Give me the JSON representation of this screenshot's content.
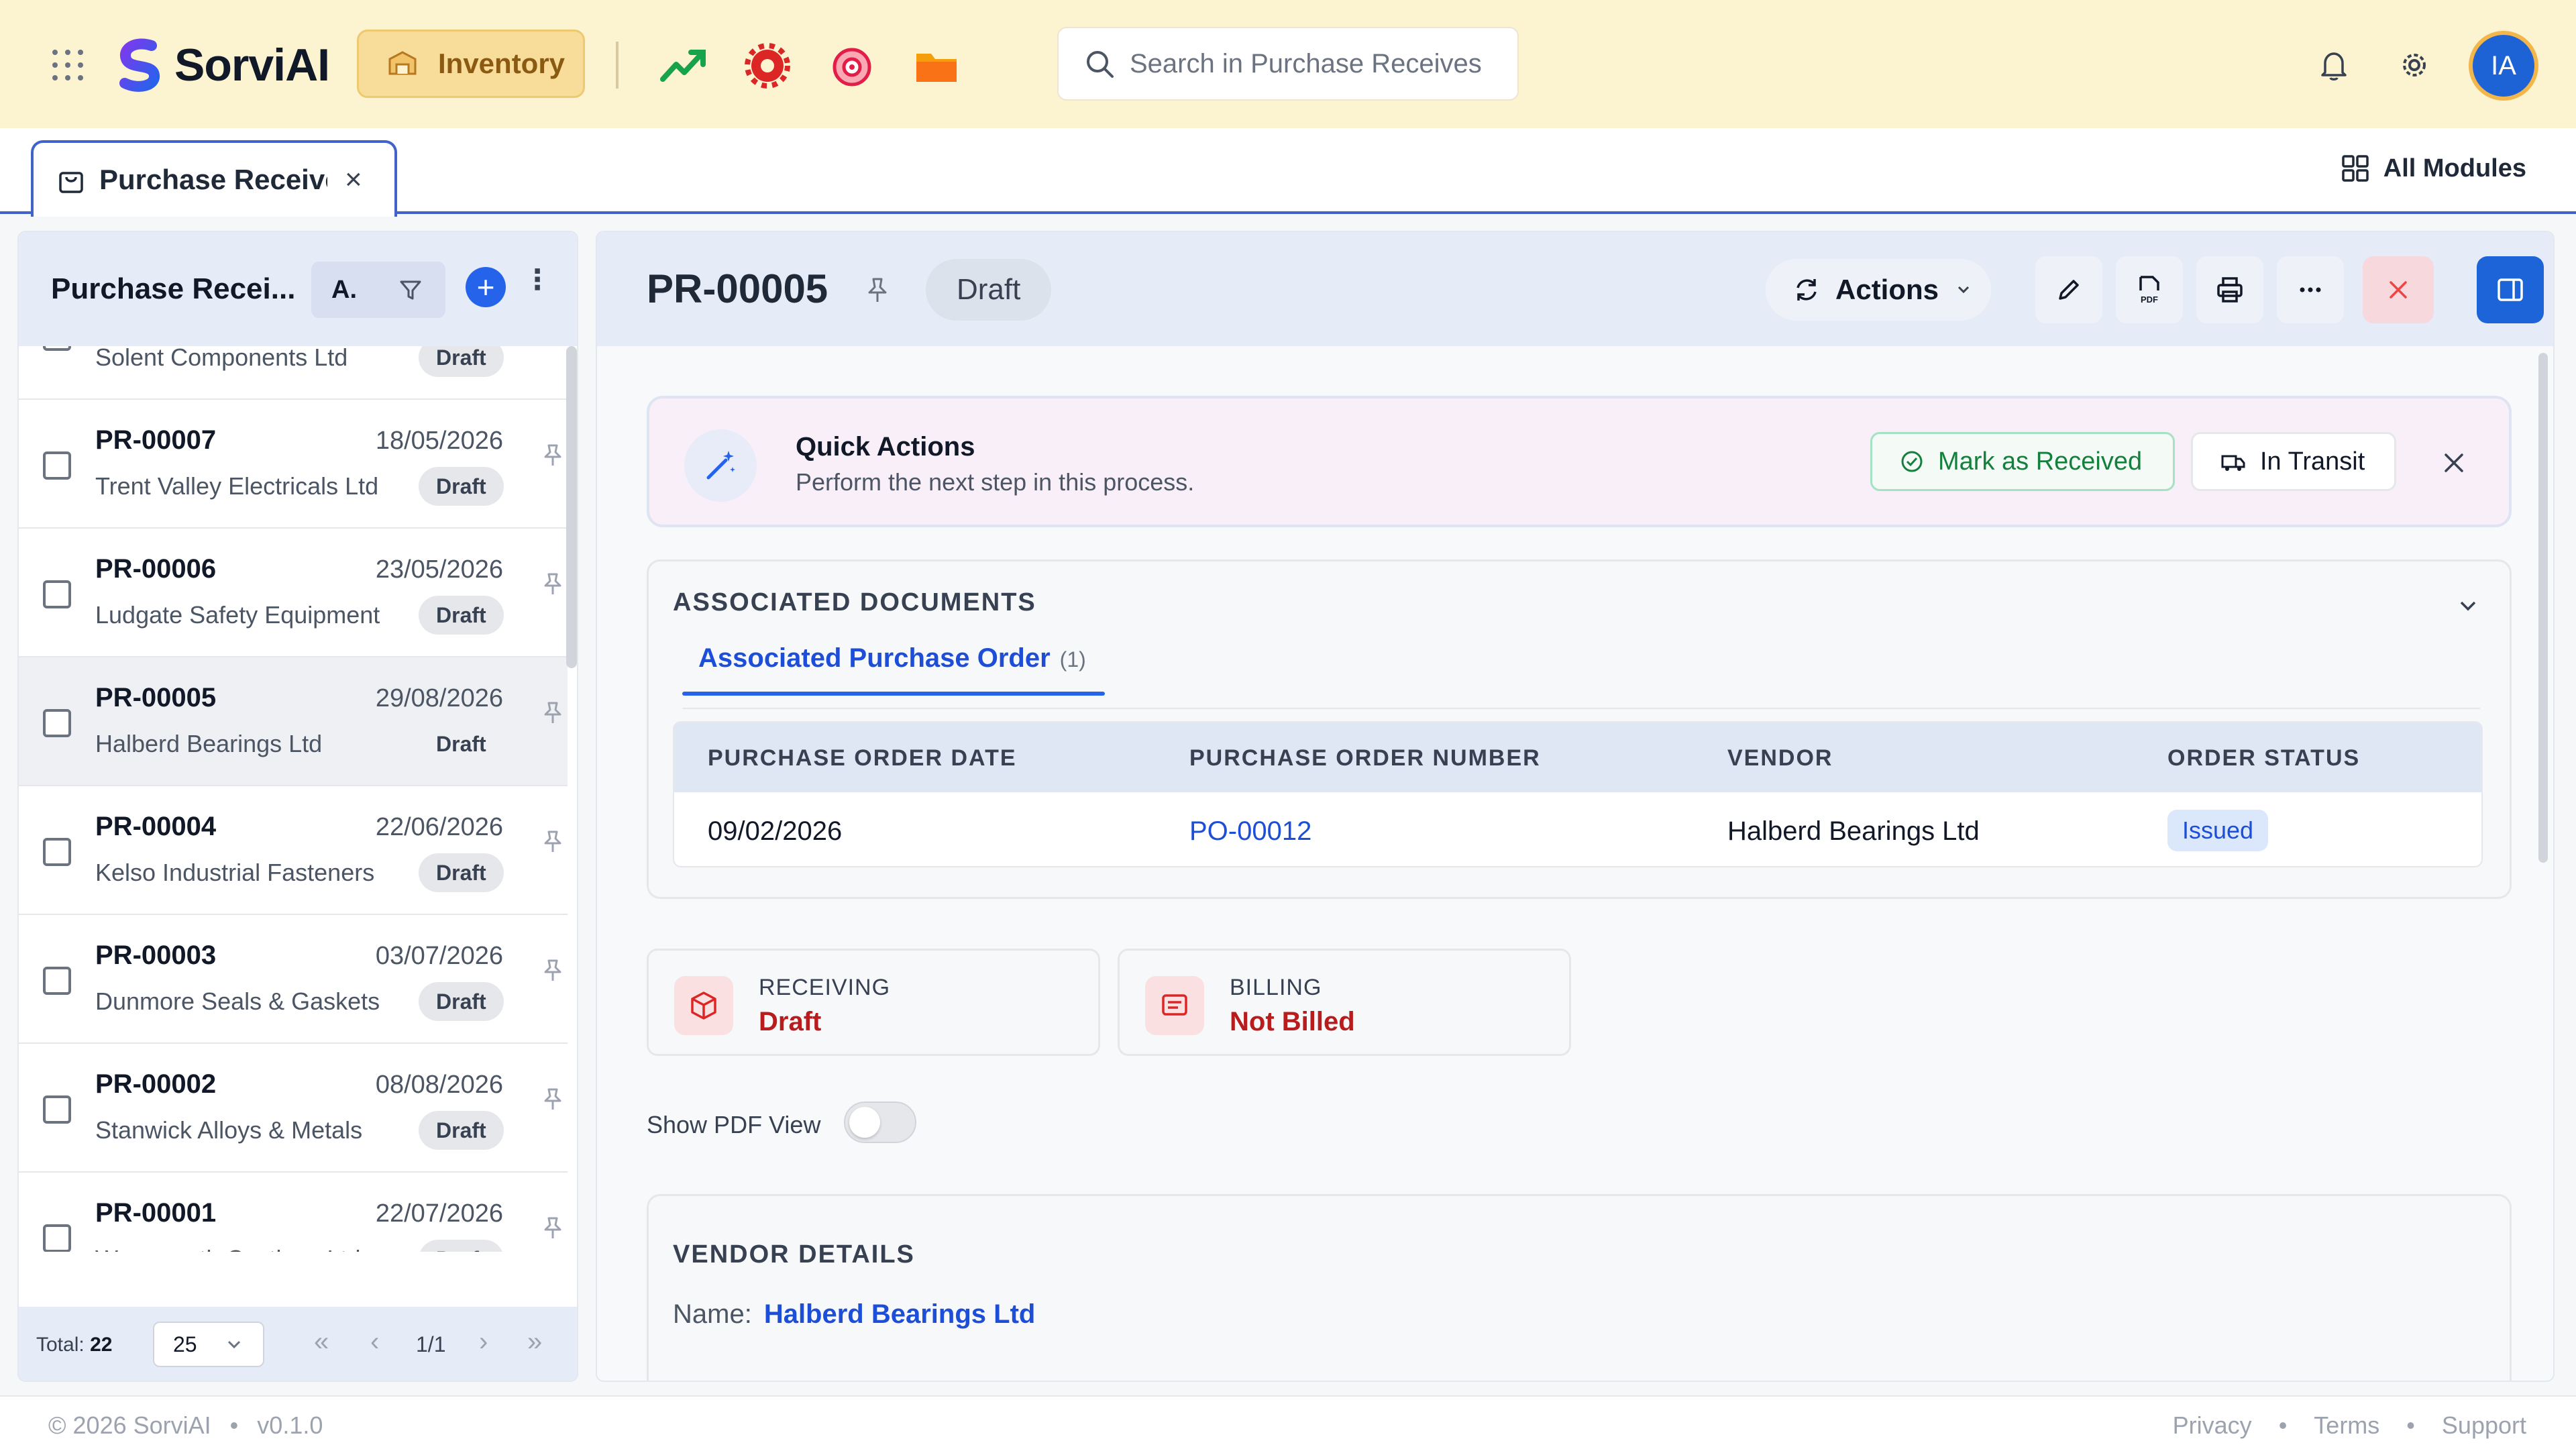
{
  "app": {
    "brand": "SorviAI",
    "module_label": "Inventory",
    "search_placeholder": "Search in Purchase Receives",
    "avatar_initials": "IA",
    "accent_color": "#2563eb",
    "header_bg": "#fcf3d1"
  },
  "tabbar": {
    "active_tab": "Purchase Receives",
    "all_modules_label": "All Modules"
  },
  "list": {
    "title": "Purchase Recei...",
    "sort_label": "A.",
    "items": [
      {
        "id": "",
        "date": "",
        "vendor": "Solent Components Ltd",
        "status": "Draft",
        "selected": false
      },
      {
        "id": "PR-00007",
        "date": "18/05/2026",
        "vendor": "Trent Valley Electricals Ltd",
        "status": "Draft",
        "selected": false
      },
      {
        "id": "PR-00006",
        "date": "23/05/2026",
        "vendor": "Ludgate Safety Equipment",
        "status": "Draft",
        "selected": false
      },
      {
        "id": "PR-00005",
        "date": "29/08/2026",
        "vendor": "Halberd Bearings Ltd",
        "status": "Draft",
        "selected": true
      },
      {
        "id": "PR-00004",
        "date": "22/06/2026",
        "vendor": "Kelso Industrial Fasteners",
        "status": "Draft",
        "selected": false
      },
      {
        "id": "PR-00003",
        "date": "03/07/2026",
        "vendor": "Dunmore Seals & Gaskets",
        "status": "Draft",
        "selected": false
      },
      {
        "id": "PR-00002",
        "date": "08/08/2026",
        "vendor": "Stanwick Alloys & Metals",
        "status": "Draft",
        "selected": false
      },
      {
        "id": "PR-00001",
        "date": "22/07/2026",
        "vendor": "Wearmouth Castings Ltd",
        "status": "Draft",
        "selected": false
      }
    ],
    "footer": {
      "total_label": "Total:",
      "total_value": "22",
      "page_size": "25",
      "page_info": "1/1"
    }
  },
  "detail": {
    "doc_id": "PR-00005",
    "status": "Draft",
    "actions_label": "Actions",
    "quick_actions": {
      "title": "Quick Actions",
      "subtitle": "Perform the next step in this process.",
      "mark_received_label": "Mark as Received",
      "in_transit_label": "In Transit"
    },
    "associated": {
      "section_title": "ASSOCIATED DOCUMENTS",
      "tab_label": "Associated Purchase Order",
      "tab_count": "(1)",
      "columns": [
        "PURCHASE ORDER DATE",
        "PURCHASE ORDER NUMBER",
        "VENDOR",
        "ORDER STATUS"
      ],
      "rows": [
        {
          "date": "09/02/2026",
          "number": "PO-00012",
          "vendor": "Halberd Bearings Ltd",
          "status": "Issued"
        }
      ]
    },
    "receiving": {
      "label": "RECEIVING",
      "value": "Draft"
    },
    "billing": {
      "label": "BILLING",
      "value": "Not Billed"
    },
    "pdf_toggle_label": "Show PDF View",
    "pdf_toggle_on": false,
    "vendor_section": {
      "title": "VENDOR DETAILS",
      "name_label": "Name:",
      "name_value": "Halberd Bearings Ltd"
    }
  },
  "footer": {
    "copyright": "© 2026 SorviAI",
    "version": "v0.1.0",
    "links": [
      "Privacy",
      "Terms",
      "Support"
    ]
  }
}
